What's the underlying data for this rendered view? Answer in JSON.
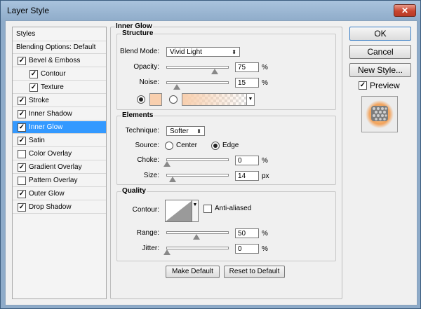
{
  "window": {
    "title": "Layer Style",
    "close_label": "✕"
  },
  "styles_panel": {
    "header": "Styles",
    "blending_options": "Blending Options: Default",
    "items": [
      {
        "label": "Bevel & Emboss",
        "checked": true,
        "indent": false
      },
      {
        "label": "Contour",
        "checked": true,
        "indent": true
      },
      {
        "label": "Texture",
        "checked": true,
        "indent": true
      },
      {
        "label": "Stroke",
        "checked": true,
        "indent": false
      },
      {
        "label": "Inner Shadow",
        "checked": true,
        "indent": false
      },
      {
        "label": "Inner Glow",
        "checked": true,
        "indent": false,
        "selected": true
      },
      {
        "label": "Satin",
        "checked": true,
        "indent": false
      },
      {
        "label": "Color Overlay",
        "checked": false,
        "indent": false
      },
      {
        "label": "Gradient Overlay",
        "checked": true,
        "indent": false
      },
      {
        "label": "Pattern Overlay",
        "checked": false,
        "indent": false
      },
      {
        "label": "Outer Glow",
        "checked": true,
        "indent": false
      },
      {
        "label": "Drop Shadow",
        "checked": true,
        "indent": false
      }
    ]
  },
  "inner_glow": {
    "title": "Inner Glow",
    "structure": {
      "title": "Structure",
      "blend_mode_label": "Blend Mode:",
      "blend_mode_value": "Vivid Light",
      "opacity_label": "Opacity:",
      "opacity_value": "75",
      "noise_label": "Noise:",
      "noise_value": "15",
      "percent": "%",
      "glow_color": "#f8cfae"
    },
    "elements": {
      "title": "Elements",
      "technique_label": "Technique:",
      "technique_value": "Softer",
      "source_label": "Source:",
      "source_center": "Center",
      "source_edge": "Edge",
      "choke_label": "Choke:",
      "choke_value": "0",
      "percent": "%",
      "size_label": "Size:",
      "size_value": "14",
      "px": "px"
    },
    "quality": {
      "title": "Quality",
      "contour_label": "Contour:",
      "anti_aliased_label": "Anti-aliased",
      "range_label": "Range:",
      "range_value": "50",
      "jitter_label": "Jitter:",
      "jitter_value": "0",
      "percent": "%"
    },
    "make_default": "Make Default",
    "reset_default": "Reset to Default"
  },
  "actions": {
    "ok": "OK",
    "cancel": "Cancel",
    "new_style": "New Style...",
    "preview_label": "Preview",
    "check": "✓"
  }
}
